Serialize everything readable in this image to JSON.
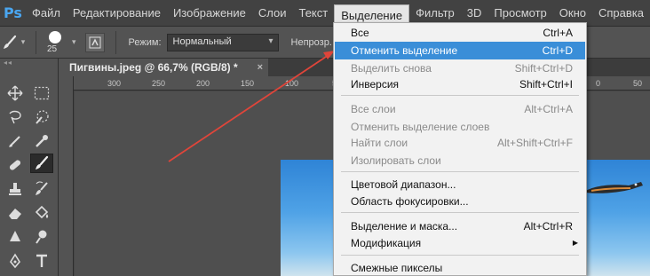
{
  "app": {
    "logo": "Ps"
  },
  "menubar": {
    "items": [
      "Файл",
      "Редактирование",
      "Изображение",
      "Слои",
      "Текст",
      "Выделение",
      "Фильтр",
      "3D",
      "Просмотр",
      "Окно",
      "Справка"
    ],
    "active": "Выделение"
  },
  "options": {
    "brush_size": "25",
    "mode_label": "Режим:",
    "mode_value": "Нормальный",
    "opacity_label": "Непрозр."
  },
  "document": {
    "tab_title": "Пигвины.jpeg @ 66,7% (RGB/8) *",
    "close": "×"
  },
  "ruler": {
    "ticks": [
      "300",
      "250",
      "200",
      "150",
      "100",
      "50",
      "0",
      "50"
    ]
  },
  "dropdown": {
    "items": [
      {
        "label": "Все",
        "shortcut": "Ctrl+A",
        "state": "enabled"
      },
      {
        "label": "Отменить выделение",
        "shortcut": "Ctrl+D",
        "state": "highlighted"
      },
      {
        "label": "Выделить снова",
        "shortcut": "Shift+Ctrl+D",
        "state": "disabled"
      },
      {
        "label": "Инверсия",
        "shortcut": "Shift+Ctrl+I",
        "state": "enabled"
      },
      {
        "label": "Все слои",
        "shortcut": "Alt+Ctrl+A",
        "state": "disabled"
      },
      {
        "label": "Отменить выделение слоев",
        "shortcut": "",
        "state": "disabled"
      },
      {
        "label": "Найти слои",
        "shortcut": "Alt+Shift+Ctrl+F",
        "state": "disabled"
      },
      {
        "label": "Изолировать слои",
        "shortcut": "",
        "state": "disabled"
      },
      {
        "label": "Цветовой диапазон...",
        "shortcut": "",
        "state": "enabled"
      },
      {
        "label": "Область фокусировки...",
        "shortcut": "",
        "state": "enabled"
      },
      {
        "label": "Выделение и маска...",
        "shortcut": "Alt+Ctrl+R",
        "state": "enabled"
      },
      {
        "label": "Модификация",
        "shortcut": "",
        "state": "enabled",
        "submenu": true
      },
      {
        "label": "Смежные пикселы",
        "shortcut": "",
        "state": "enabled"
      }
    ]
  },
  "colors": {
    "highlight": "#3a8ed8",
    "annotation_arrow": "#e0453a",
    "logo": "#4aa6f0"
  }
}
